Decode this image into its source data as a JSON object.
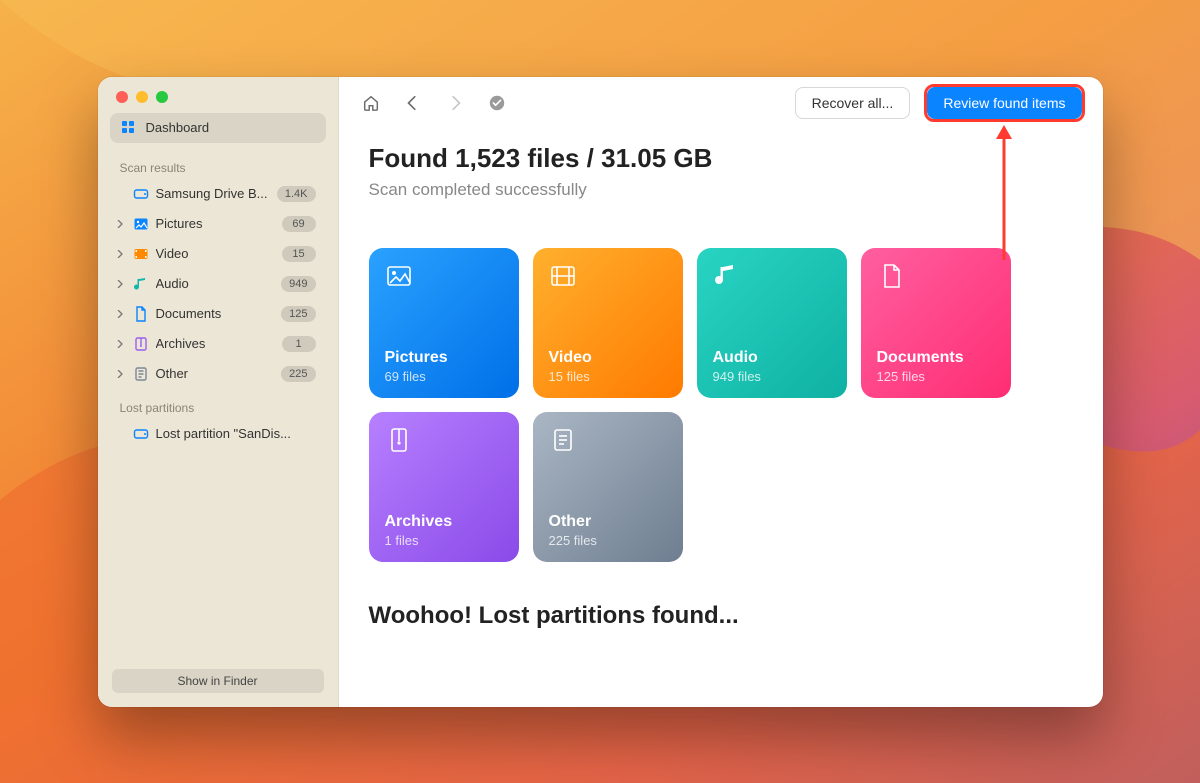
{
  "sidebar": {
    "dashboard_label": "Dashboard",
    "section_results": "Scan results",
    "section_lost": "Lost partitions",
    "drive_label": "Samsung Drive B...",
    "drive_badge": "1.4K",
    "items": [
      {
        "label": "Pictures",
        "badge": "69"
      },
      {
        "label": "Video",
        "badge": "15"
      },
      {
        "label": "Audio",
        "badge": "949"
      },
      {
        "label": "Documents",
        "badge": "125"
      },
      {
        "label": "Archives",
        "badge": "1"
      },
      {
        "label": "Other",
        "badge": "225"
      }
    ],
    "lost_item_label": "Lost partition \"SanDis...",
    "footer_label": "Show in Finder"
  },
  "toolbar": {
    "recover_label": "Recover all...",
    "review_label": "Review found items"
  },
  "summary": {
    "title": "Found 1,523 files / 31.05 GB",
    "subtitle": "Scan completed successfully"
  },
  "tiles": [
    {
      "title": "Pictures",
      "subtitle": "69 files",
      "class": "g-pictures",
      "icon": "picture"
    },
    {
      "title": "Video",
      "subtitle": "15 files",
      "class": "g-video",
      "icon": "video"
    },
    {
      "title": "Audio",
      "subtitle": "949 files",
      "class": "g-audio",
      "icon": "audio"
    },
    {
      "title": "Documents",
      "subtitle": "125 files",
      "class": "g-documents",
      "icon": "document"
    },
    {
      "title": "Archives",
      "subtitle": "1 files",
      "class": "g-archives",
      "icon": "archive"
    },
    {
      "title": "Other",
      "subtitle": "225 files",
      "class": "g-other",
      "icon": "other"
    }
  ],
  "bottom_heading": "Woohoo! Lost partitions found...",
  "colors": {
    "accent": "#0a84ff",
    "highlight": "#ff3b30"
  }
}
